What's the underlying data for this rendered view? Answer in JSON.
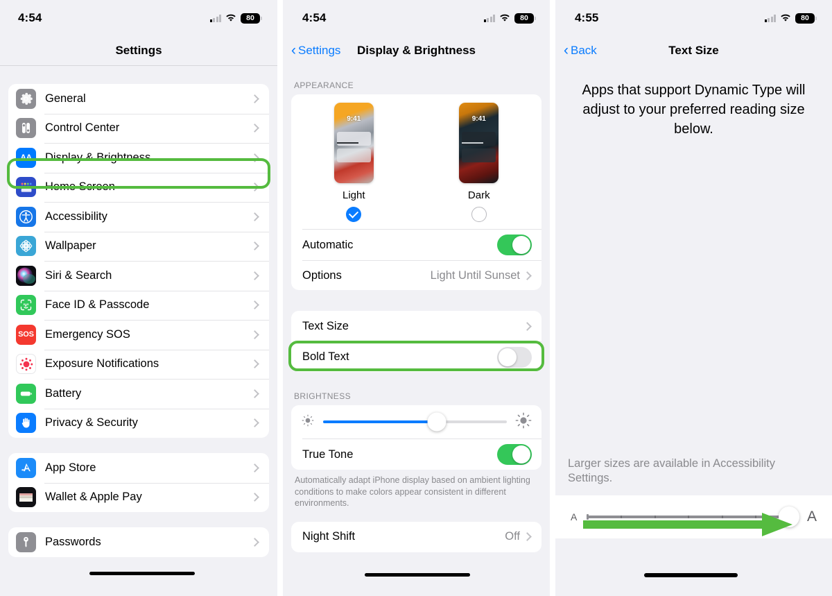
{
  "panel1": {
    "status": {
      "time": "4:54",
      "battery": "80",
      "signal_icon": "cellular-bars-icon",
      "wifi_icon": "wifi-icon",
      "battery_icon": "battery-icon"
    },
    "nav": {
      "title": "Settings"
    },
    "groups": [
      {
        "items": [
          {
            "label": "General",
            "icon": "gear-icon",
            "chevron": "›"
          },
          {
            "label": "Control Center",
            "icon": "control-center-icon",
            "chevron": "›"
          },
          {
            "label": "Display & Brightness",
            "icon": "display-brightness-icon",
            "chevron": "›",
            "highlighted": true
          },
          {
            "label": "Home Screen",
            "icon": "home-screen-icon",
            "chevron": "›"
          },
          {
            "label": "Accessibility",
            "icon": "accessibility-icon",
            "chevron": "›"
          },
          {
            "label": "Wallpaper",
            "icon": "wallpaper-icon",
            "chevron": "›"
          },
          {
            "label": "Siri & Search",
            "icon": "siri-icon",
            "chevron": "›"
          },
          {
            "label": "Face ID & Passcode",
            "icon": "face-id-icon",
            "chevron": "›"
          },
          {
            "label": "Emergency SOS",
            "icon": "sos-icon",
            "chevron": "›"
          },
          {
            "label": "Exposure Notifications",
            "icon": "exposure-notifications-icon",
            "chevron": "›"
          },
          {
            "label": "Battery",
            "icon": "battery-settings-icon",
            "chevron": "›"
          },
          {
            "label": "Privacy & Security",
            "icon": "privacy-hand-icon",
            "chevron": "›"
          }
        ]
      },
      {
        "items": [
          {
            "label": "App Store",
            "icon": "app-store-icon",
            "chevron": "›"
          },
          {
            "label": "Wallet & Apple Pay",
            "icon": "wallet-icon",
            "chevron": "›"
          }
        ]
      },
      {
        "items": [
          {
            "label": "Passwords",
            "icon": "passwords-key-icon",
            "chevron": "›"
          }
        ]
      }
    ]
  },
  "panel2": {
    "status": {
      "time": "4:54",
      "battery": "80"
    },
    "nav": {
      "back_label": "Settings",
      "back_chevron": "‹",
      "title": "Display & Brightness"
    },
    "appearance": {
      "header": "APPEARANCE",
      "light": {
        "label": "Light",
        "preview_time": "9:41",
        "selected": true
      },
      "dark": {
        "label": "Dark",
        "preview_time": "9:41",
        "selected": false
      },
      "automatic": {
        "label": "Automatic",
        "on": true
      },
      "options": {
        "label": "Options",
        "value": "Light Until Sunset",
        "chevron": "›"
      }
    },
    "text": {
      "text_size": {
        "label": "Text Size",
        "chevron": "›",
        "highlighted": true
      },
      "bold_text": {
        "label": "Bold Text",
        "on": false
      }
    },
    "brightness": {
      "header": "BRIGHTNESS",
      "level_percent": 62,
      "low_icon": "brightness-low-icon",
      "high_icon": "brightness-high-icon",
      "true_tone": {
        "label": "True Tone",
        "on": true
      },
      "footnote": "Automatically adapt iPhone display based on ambient lighting conditions to make colors appear consistent in different environments.",
      "night_shift": {
        "label": "Night Shift",
        "value": "Off",
        "chevron": "›"
      }
    }
  },
  "panel3": {
    "status": {
      "time": "4:55",
      "battery": "80"
    },
    "nav": {
      "back_label": "Back",
      "back_chevron": "‹",
      "title": "Text Size"
    },
    "intro": "Apps that support Dynamic Type will adjust to your preferred reading size below.",
    "note": "Larger sizes are available in Accessibility Settings.",
    "size_slider": {
      "small_label": "A",
      "large_label": "A",
      "position_percent": 96,
      "tick_count": 6,
      "annotation_icon": "green-arrow-right-icon"
    }
  },
  "colors": {
    "highlight_green": "#55bb3f",
    "ios_blue": "#0a7cff",
    "ios_green": "#34c759",
    "panel_bg": "#f1f1f5"
  }
}
